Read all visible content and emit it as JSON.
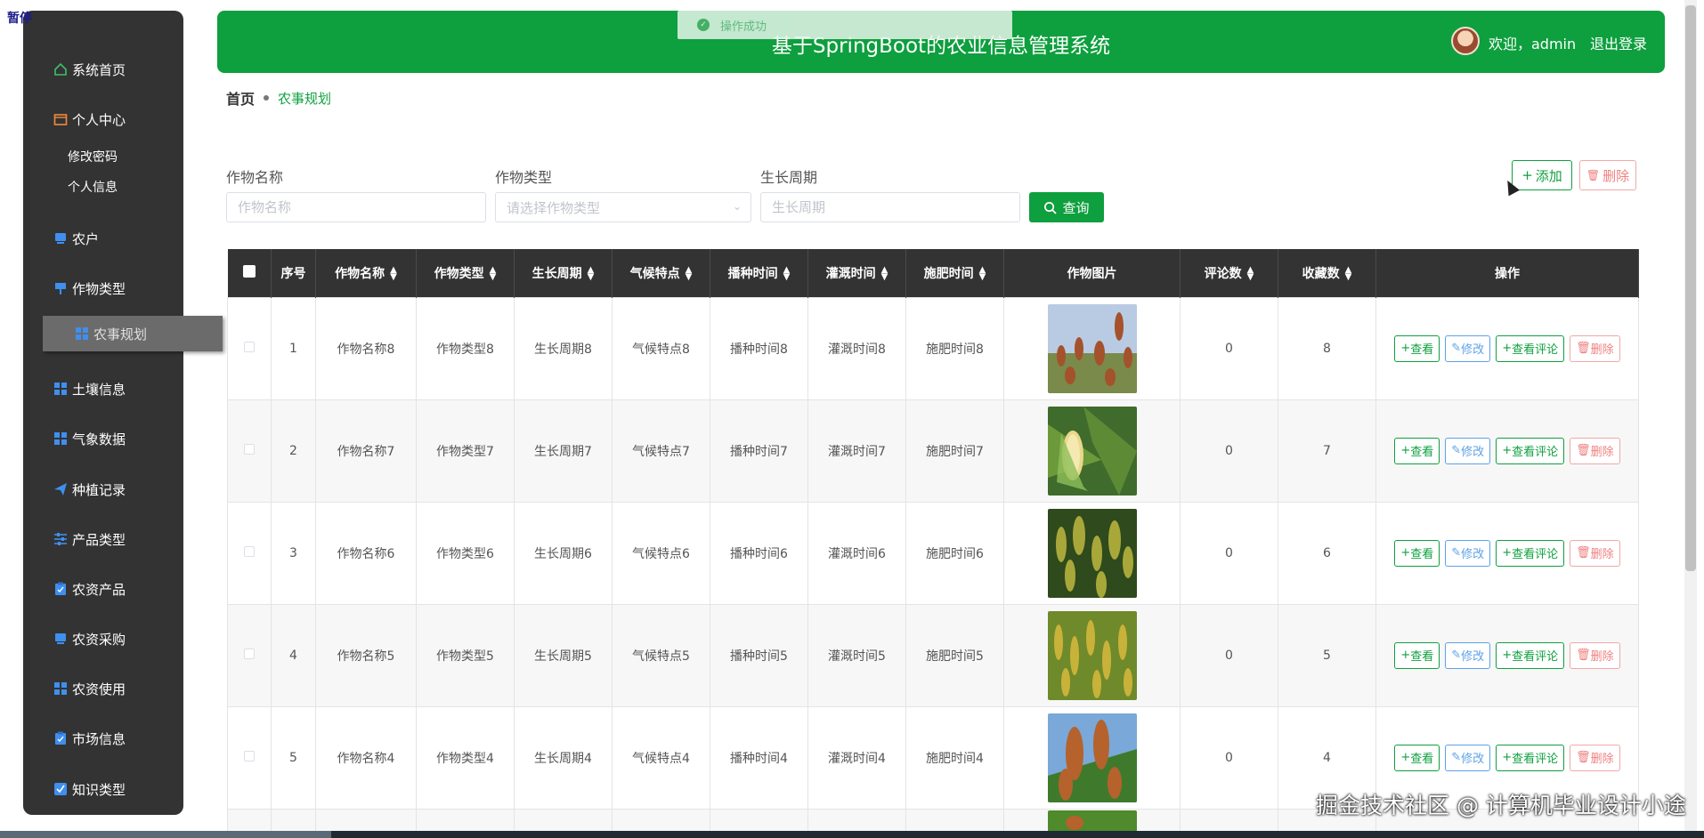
{
  "corner_label": "暂停",
  "header": {
    "title": "基于SpringBoot的农业信息管理系统",
    "welcome": "欢迎，admin",
    "logout": "退出登录",
    "brand_color": "#0e9f3e"
  },
  "toast": {
    "text": "操作成功",
    "icon": "check-circle-icon"
  },
  "sidebar": {
    "items": [
      {
        "label": "系统首页",
        "icon": "home-icon"
      },
      {
        "label": "个人中心",
        "icon": "wallet-icon"
      },
      {
        "label": "农户",
        "icon": "monitor-icon"
      },
      {
        "label": "作物类型",
        "icon": "sign-icon"
      },
      {
        "label": "农事规划",
        "icon": "grid-icon",
        "active": true
      },
      {
        "label": "土壤信息",
        "icon": "grid-icon"
      },
      {
        "label": "气象数据",
        "icon": "grid-icon"
      },
      {
        "label": "种植记录",
        "icon": "send-icon"
      },
      {
        "label": "产品类型",
        "icon": "sliders-icon"
      },
      {
        "label": "农资产品",
        "icon": "clipboard-icon"
      },
      {
        "label": "农资采购",
        "icon": "monitor-icon"
      },
      {
        "label": "农资使用",
        "icon": "grid-icon"
      },
      {
        "label": "市场信息",
        "icon": "clipboard-check-icon"
      },
      {
        "label": "知识类型",
        "icon": "check-square-icon"
      }
    ],
    "sub_items": [
      {
        "label": "修改密码"
      },
      {
        "label": "个人信息"
      }
    ]
  },
  "breadcrumb": {
    "home": "首页",
    "current": "农事规划"
  },
  "search": {
    "name_label": "作物名称",
    "name_placeholder": "作物名称",
    "type_label": "作物类型",
    "type_placeholder": "请选择作物类型",
    "cycle_label": "生长周期",
    "cycle_placeholder": "生长周期",
    "query_label": "查询",
    "add_label": "添加",
    "delete_label": "删除"
  },
  "table": {
    "headers": [
      "序号",
      "作物名称",
      "作物类型",
      "生长周期",
      "气候特点",
      "播种时间",
      "灌溉时间",
      "施肥时间",
      "作物图片",
      "评论数",
      "收藏数",
      "操作"
    ],
    "rows": [
      {
        "no": "1",
        "name": "作物名称8",
        "type": "作物类型8",
        "cycle": "生长周期8",
        "climate": "气候特点8",
        "sow": "播种时间8",
        "irrigate": "灌溉时间8",
        "fertilize": "施肥时间8",
        "comments": "0",
        "favorites": "8",
        "image": "sorghum-field-photo"
      },
      {
        "no": "2",
        "name": "作物名称7",
        "type": "作物类型7",
        "cycle": "生长周期7",
        "climate": "气候特点7",
        "sow": "播种时间7",
        "irrigate": "灌溉时间7",
        "fertilize": "施肥时间7",
        "comments": "0",
        "favorites": "7",
        "image": "corn-ear-photo"
      },
      {
        "no": "3",
        "name": "作物名称6",
        "type": "作物类型6",
        "cycle": "生长周期6",
        "climate": "气候特点6",
        "sow": "播种时间6",
        "irrigate": "灌溉时间6",
        "fertilize": "施肥时间6",
        "comments": "0",
        "favorites": "6",
        "image": "millet-photo"
      },
      {
        "no": "4",
        "name": "作物名称5",
        "type": "作物类型5",
        "cycle": "生长周期5",
        "climate": "气候特点5",
        "sow": "播种时间5",
        "irrigate": "灌溉时间5",
        "fertilize": "施肥时间5",
        "comments": "0",
        "favorites": "5",
        "image": "rice-field-photo"
      },
      {
        "no": "5",
        "name": "作物名称4",
        "type": "作物类型4",
        "cycle": "生长周期4",
        "climate": "气候特点4",
        "sow": "播种时间4",
        "irrigate": "灌溉时间4",
        "fertilize": "施肥时间4",
        "comments": "0",
        "favorites": "4",
        "image": "sorghum-closeup-photo"
      }
    ],
    "actions": {
      "view": "查看",
      "edit": "修改",
      "comments": "查看评论",
      "delete": "删除"
    }
  },
  "watermark": "掘金技术社区 @ 计算机毕业设计小途"
}
